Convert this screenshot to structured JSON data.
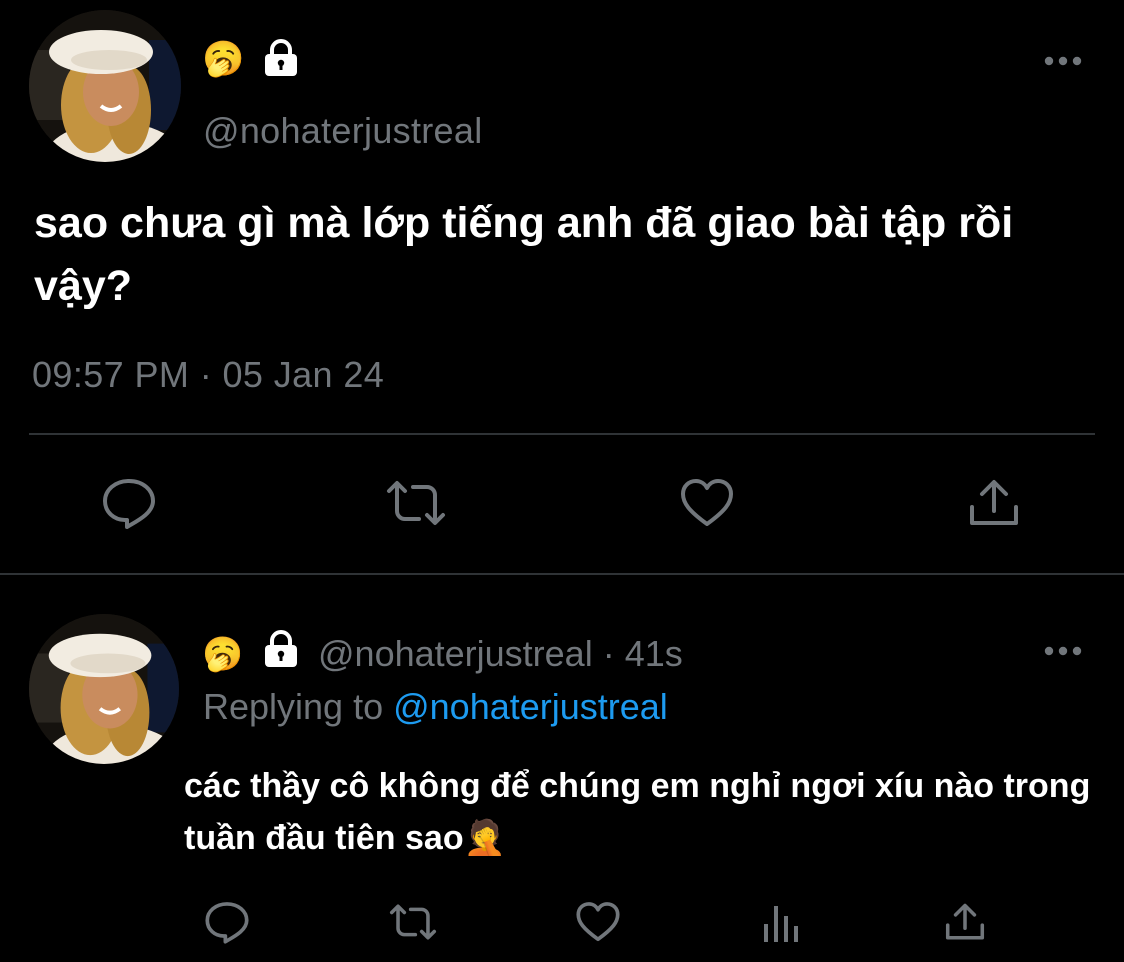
{
  "tweet": {
    "author": {
      "status_emoji": "🥱",
      "lock_icon": "lock-icon",
      "handle": "@nohaterjustreal"
    },
    "more_icon": "more-horizontal-icon",
    "text": "sao chưa gì mà lớp tiếng anh đã giao bài tập rồi vậy?",
    "timestamp": "09:57 PM · 05 Jan 24",
    "actions": [
      "reply-icon",
      "retweet-icon",
      "like-icon",
      "share-icon"
    ]
  },
  "reply": {
    "author": {
      "status_emoji": "🥱",
      "lock_icon": "lock-icon",
      "handle": "@nohaterjustreal",
      "separator": " · ",
      "age": "41s"
    },
    "replying_prefix": "Replying to ",
    "replying_to": "@nohaterjustreal",
    "text": "các thầy cô không để chúng em nghỉ ngơi xíu nào trong tuần đầu tiên sao",
    "text_emoji": "🤦",
    "actions": [
      "reply-icon",
      "retweet-icon",
      "like-icon",
      "stats-icon",
      "share-icon"
    ]
  },
  "colors": {
    "background": "#000000",
    "primary_text": "#ffffff",
    "secondary_text": "#71767b",
    "link": "#1d9bf0",
    "divider": "#2f3336"
  }
}
